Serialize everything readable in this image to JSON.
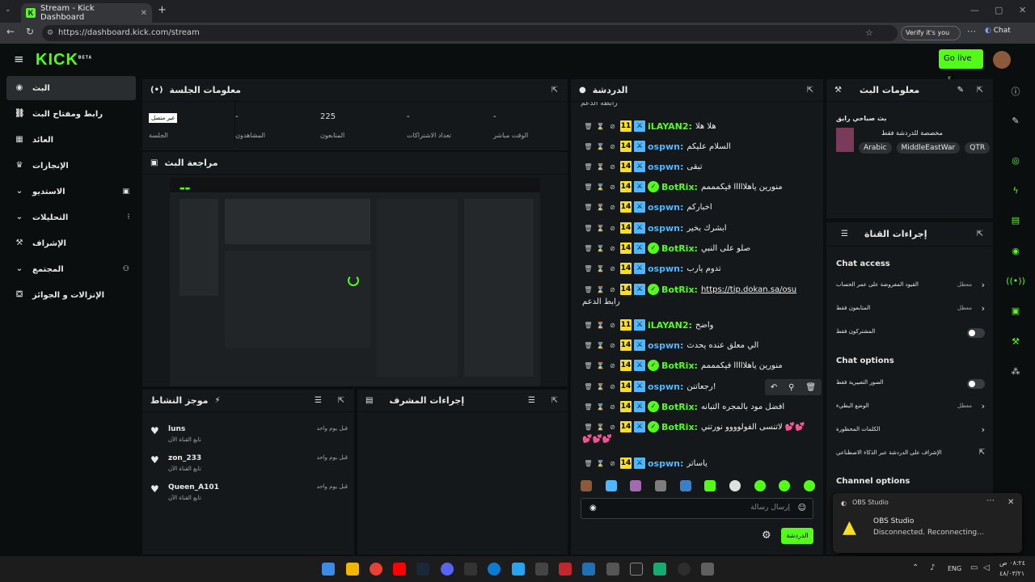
{
  "browser": {
    "tab_title": "Stream - Kick Dashboard",
    "url": "https://dashboard.kick.com/stream",
    "verify_label": "Verify it's you",
    "chat_label": "Chat"
  },
  "header": {
    "logo": "KICK",
    "logo_badge": "BETA",
    "go_live": "Go live"
  },
  "sidebar": {
    "items": [
      {
        "label": "البث",
        "icon": "live-icon"
      },
      {
        "label": "رابط ومفتاح البث",
        "icon": "link-icon"
      },
      {
        "label": "العائد",
        "icon": "revenue-icon"
      },
      {
        "label": "الإنجازات",
        "icon": "trophy-icon"
      },
      {
        "label": "الاستديو",
        "icon": "studio-icon"
      },
      {
        "label": "التحليلات",
        "icon": "analytics-icon"
      },
      {
        "label": "الإشراف",
        "icon": "moderation-icon"
      },
      {
        "label": "المجتمع",
        "icon": "community-icon"
      },
      {
        "label": "الإنزالات و الجوائز",
        "icon": "drops-icon"
      }
    ]
  },
  "session": {
    "title": "معلومات الجلسة",
    "status_badge": "غير متصل",
    "status_label": "الجلسة",
    "stats": [
      {
        "value": "-",
        "label": "المشاهدون"
      },
      {
        "value": "225",
        "label": "المتابعون"
      },
      {
        "value": "-",
        "label": "تعداد الاشتراكات"
      },
      {
        "value": "-",
        "label": "الوقت مباشر"
      }
    ]
  },
  "preview": {
    "title": "مراجعة البث"
  },
  "activity": {
    "title": "موجز النشاط",
    "items": [
      {
        "user": "luns",
        "time": "قبل يوم واحد",
        "action": "تابع القناة الآن"
      },
      {
        "user": "zon_233",
        "time": "قبل يوم واحد",
        "action": "تابع القناة الآن"
      },
      {
        "user": "Queen_A101",
        "time": "قبل يوم واحد",
        "action": "تابع القناة الآن"
      }
    ]
  },
  "mod_actions": {
    "title": "إجراءات المشرف"
  },
  "chat": {
    "title": "الدردشة",
    "partial_top": "رابطه الدعم",
    "messages": [
      {
        "user": "iLAYAN2:",
        "badge": "11",
        "text": "هلا هلا",
        "color": "#53fc18"
      },
      {
        "user": "ospwn:",
        "badge": "14",
        "text": "السلام عليكم",
        "color": "#4db8ff"
      },
      {
        "user": "ospwn:",
        "badge": "14",
        "text": "تبقى",
        "color": "#4db8ff"
      },
      {
        "user": "BotRix:",
        "badge": "14",
        "text": "منورين ياهلااااا فيكمممم",
        "color": "#53fc18",
        "check": true
      },
      {
        "user": "ospwn:",
        "badge": "14",
        "text": "اخباركم",
        "color": "#4db8ff"
      },
      {
        "user": "ospwn:",
        "badge": "14",
        "text": "ابشرك بخير",
        "color": "#4db8ff"
      },
      {
        "user": "BotRix:",
        "badge": "14",
        "text": "صلو على النبي",
        "color": "#53fc18",
        "check": true
      },
      {
        "user": "ospwn:",
        "badge": "14",
        "text": "تدوم يارب",
        "color": "#4db8ff"
      },
      {
        "user": "BotRix:",
        "badge": "14",
        "text": "https://tip.dokan.sa/osu",
        "color": "#53fc18",
        "check": true,
        "wrap": "رابط الدعم"
      },
      {
        "user": "iLAYAN2:",
        "badge": "11",
        "text": "واضح",
        "color": "#53fc18"
      },
      {
        "user": "ospwn:",
        "badge": "14",
        "text": "الي معلق عنده يحدث",
        "color": "#4db8ff"
      },
      {
        "user": "BotRix:",
        "badge": "14",
        "text": "منورين ياهلااااا فيكمممم",
        "color": "#53fc18",
        "check": true
      },
      {
        "user": "ospwn:",
        "badge": "14",
        "text": "رجعاتنن!",
        "color": "#4db8ff"
      },
      {
        "user": "BotRix:",
        "badge": "14",
        "text": "افضل مود بالمجره التبانه",
        "color": "#53fc18",
        "check": true
      },
      {
        "user": "BotRix:",
        "badge": "14",
        "text": "لاتنسى الفولوووو نورتني 💕💕",
        "color": "#53fc18",
        "check": true,
        "wrap": "💕💕💕"
      },
      {
        "user": "ospwn:",
        "badge": "14",
        "text": "ياساتر",
        "color": "#4db8ff"
      }
    ],
    "input_placeholder": "إرسال رسالة",
    "send_button": "الدردشة"
  },
  "stream_info": {
    "title": "معلومات البث",
    "stream_title": "بث صباحي رايق",
    "subtitle": "مخصصة للدردشة فقط",
    "tags": [
      "Arabic",
      "MiddleEastWar",
      "QTR"
    ]
  },
  "channel_actions": {
    "title": "إجراءات القناة",
    "chat_access_heading": "Chat access",
    "chat_access_rows": [
      {
        "label": "القيود المفروضة على عمر الحساب",
        "state": "معطل",
        "type": "arrow"
      },
      {
        "label": "المتابعون فقط",
        "state": "معطل",
        "type": "arrow"
      },
      {
        "label": "المشتركون فقط",
        "type": "toggle"
      }
    ],
    "chat_options_heading": "Chat options",
    "chat_options_rows": [
      {
        "label": "الصور التعبيرية فقط",
        "type": "toggle"
      },
      {
        "label": "الوضع البطيء",
        "state": "معطل",
        "type": "arrow"
      },
      {
        "label": "الكلمات المحظورة",
        "type": "arrow"
      },
      {
        "label": "الإشراف على الدردشة عبر الذكاء الاصطناعي",
        "type": "external"
      }
    ],
    "channel_options_heading": "Channel options"
  },
  "notification": {
    "app": "OBS Studio",
    "title": "OBS Studio",
    "body": "Disconnected. Reconnecting..."
  },
  "taskbar": {
    "lang": "ENG",
    "time": "٠٨:٢٤ ص",
    "date": "٤٨/٠٣/٢١"
  }
}
